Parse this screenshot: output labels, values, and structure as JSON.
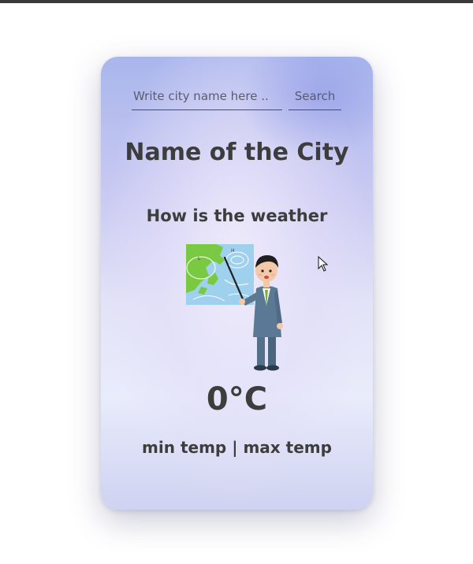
{
  "search": {
    "placeholder": "Write city name here ..",
    "button_label": "Search"
  },
  "weather": {
    "city_name": "Name of the City",
    "description": "How is the weather",
    "illustration": "weather-forecaster-illustration",
    "temperature": "0°C",
    "min_max": "min temp | max temp"
  },
  "colors": {
    "text": "#3d3d3d",
    "card_top": "#a9b6ec",
    "card_bottom": "#e9ecfb"
  }
}
